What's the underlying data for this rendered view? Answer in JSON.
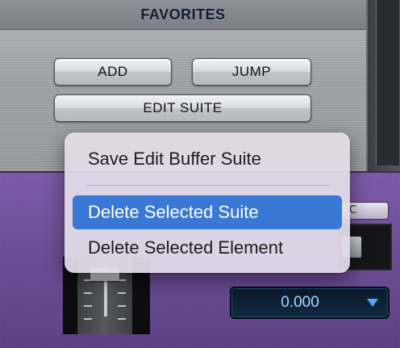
{
  "favorites": {
    "title": "FAVORITES",
    "buttons": {
      "add": "ADD",
      "jump": "JUMP",
      "edit_suite": "EDIT SUITE"
    }
  },
  "context_menu": {
    "items": [
      {
        "label": "Save Edit Buffer Suite",
        "selected": false
      },
      {
        "label": "Delete Selected Suite",
        "selected": true
      },
      {
        "label": "Delete Selected Element",
        "selected": false
      }
    ]
  },
  "value_field": {
    "value": "0.000",
    "arrow_icon": "dropdown-arrow-icon"
  },
  "colors": {
    "menu_highlight": "#3a78d6",
    "purple_panel": "#6a4a93",
    "value_text": "#a9d8ff"
  }
}
